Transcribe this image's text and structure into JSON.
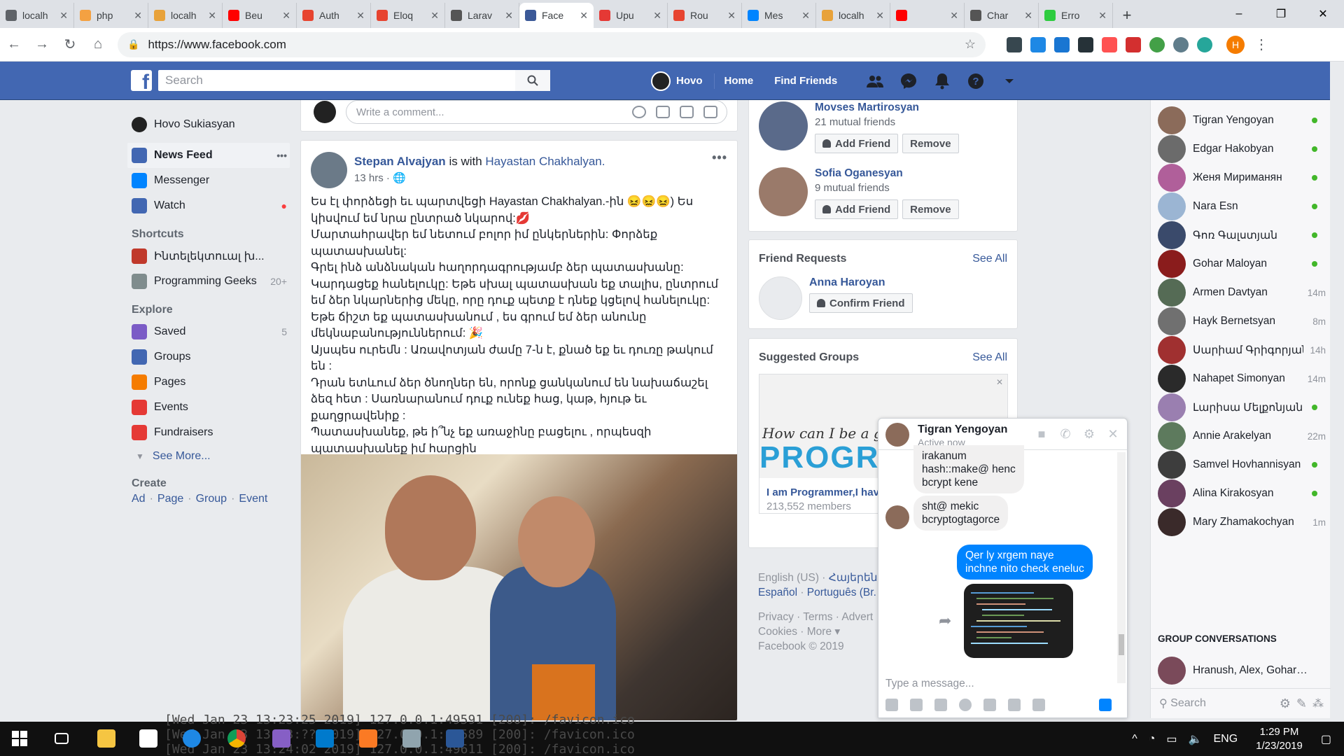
{
  "browser": {
    "tabs": [
      {
        "title": "localh",
        "color": "#5f6368"
      },
      {
        "title": "php",
        "color": "#f4a142"
      },
      {
        "title": "localh",
        "color": "#e8a23a"
      },
      {
        "title": "Bеu",
        "color": "#ff0000"
      },
      {
        "title": "Auth",
        "color": "#e74430"
      },
      {
        "title": "Eloq",
        "color": "#e74430"
      },
      {
        "title": "Larav",
        "color": "#555555"
      },
      {
        "title": "Face",
        "color": "#3b5998",
        "active": true
      },
      {
        "title": "Upu",
        "color": "#e53935"
      },
      {
        "title": "Rou",
        "color": "#e74430"
      },
      {
        "title": "Mes",
        "color": "#0084ff"
      },
      {
        "title": "localh",
        "color": "#e8a23a"
      },
      {
        "title": "",
        "color": "#ff0000"
      },
      {
        "title": "Char",
        "color": "#555555"
      },
      {
        "title": "Erro",
        "color": "#2ecc40"
      }
    ],
    "url": "https://www.facebook.com",
    "profile_initial": "H",
    "window_controls": [
      "–",
      "❐",
      "✕"
    ]
  },
  "fb": {
    "search_placeholder": "Search",
    "user_short": "Hovo",
    "nav_home": "Home",
    "nav_find_friends": "Find Friends"
  },
  "leftnav": {
    "profile_name": "Hovo Sukiasyan",
    "items": [
      {
        "label": "News Feed",
        "color": "#4267b2",
        "selected": true
      },
      {
        "label": "Messenger",
        "color": "#0084ff"
      },
      {
        "label": "Watch",
        "color": "#4267b2",
        "dot": true
      }
    ],
    "shortcuts_head": "Shortcuts",
    "shortcuts": [
      {
        "label": "Ինտելեկտուալ խ...",
        "color": "#c0392b",
        "count": ""
      },
      {
        "label": "Programming Geeks",
        "color": "#7f8c8d",
        "count": "20+"
      }
    ],
    "explore_head": "Explore",
    "explore": [
      {
        "label": "Saved",
        "color": "#7b5bc6",
        "count": "5"
      },
      {
        "label": "Groups",
        "color": "#4267b2",
        "count": ""
      },
      {
        "label": "Pages",
        "color": "#f57c00",
        "count": ""
      },
      {
        "label": "Events",
        "color": "#e53935",
        "count": ""
      },
      {
        "label": "Fundraisers",
        "color": "#e53935",
        "count": ""
      }
    ],
    "see_more": "See More...",
    "create_head": "Create",
    "create_links": [
      "Ad",
      "Page",
      "Group",
      "Event"
    ]
  },
  "comment_placeholder": "Write a comment...",
  "post": {
    "author": "Stepan Alvajyan",
    "with_text": "is with",
    "with_name": "Hayastan Chakhalyan.",
    "time": "13 hrs",
    "more": "•••",
    "text": "Ես էլ փորձեցի եւ պարտվեցի Hayastan Chakhalyan.-ին 😖😖😖) Ես կիսվում եմ նրա ընտրած նկարով:💋\nՄարտահրավեր եմ նետում բոլոր իմ ընկերներին: Փորձեք պատասխանել:\nԳրել ինձ անձնական հաղորդագրությամբ ձեր պատասխանը:\nԿարդացեք հանելուկը: Եթե սխալ պատասխան եք տալիս, ընտրում եմ ձեր նկարներից մեկը, որը դուք պետք է դնեք կցելով հանելուկը: Եթե ճիշտ եք պատասխանում , ես գրում եմ ձեր անունը մեկնաբանություններում: 🎉\nԱյսպես ուրեմն : Առավոտյան ժամը 7-ն է, քնած եք եւ դուռը թակում են :\nԴրան ետևում ձեր ծնողներ են, որոնք ցանկանում են նախաճաշել ձեզ հետ : Սառնարանում դուք ունեք հաց, կաթ, հյութ եւ քաղցրավենիք :\nՊատասխանեք, թե ի՞նչ եք առաջինը բացելու , որպեսզի պատասխանեք իմ հարցին\nՄիայն թե պատասխանը պետք է լինի անձնական նամակով :\nՄեկնաբանությունները կջնջվեն:"
  },
  "pymk": [
    {
      "name": "Movses Martirosyan",
      "mutual": "21 mutual friends",
      "add": "Add Friend",
      "remove": "Remove"
    },
    {
      "name": "Sofia Oganesyan",
      "mutual": "9 mutual friends",
      "add": "Add Friend",
      "remove": "Remove"
    }
  ],
  "friend_requests": {
    "title": "Friend Requests",
    "see_all": "See All",
    "name": "Anna Haroyan",
    "confirm": "Confirm Friend"
  },
  "suggested_groups": {
    "title": "Suggested Groups",
    "see_all": "See All",
    "img_line1": "How can I be a good",
    "img_line2": "PROGRA",
    "name": "I am Programmer,I have no life.",
    "members": "213,552 members",
    "close": "✕"
  },
  "footer": {
    "lang1": "English (US)",
    "lang1b": "Հայերեն",
    "lang2": "Español",
    "lang2b": "Português (Br...",
    "links1": "Privacy · Terms · Advert",
    "links2": "Cookies · More ▾",
    "copyright": "Facebook © 2019"
  },
  "contacts": [
    {
      "name": "Tigran Yengoyan",
      "status": "",
      "online": true,
      "color": "#8b6b5a"
    },
    {
      "name": "Edgar Hakobyan",
      "status": "",
      "online": true,
      "color": "#6b6b6b"
    },
    {
      "name": "Женя Мириманян",
      "status": "",
      "online": true,
      "color": "#b05f9a"
    },
    {
      "name": "Nara Esn",
      "status": "",
      "online": true,
      "color": "#9bb5d3"
    },
    {
      "name": "Գոռ Գալստյան",
      "status": "",
      "online": true,
      "color": "#3a4a6b"
    },
    {
      "name": "Gohar Maloyan",
      "status": "",
      "online": true,
      "color": "#8a1c1c"
    },
    {
      "name": "Armen Davtyan",
      "status": "14m",
      "online": false,
      "color": "#556b55"
    },
    {
      "name": "Hayk Bernetsyan",
      "status": "8m",
      "online": false,
      "color": "#707070"
    },
    {
      "name": "Սարիամ Գրիգորյան",
      "status": "14h",
      "online": false,
      "color": "#a03030"
    },
    {
      "name": "Nahapet Simonyan",
      "status": "14m",
      "online": false,
      "color": "#2a2a2a"
    },
    {
      "name": "Լարիսա Մելքոնյան",
      "status": "",
      "online": true,
      "color": "#9a7fb0"
    },
    {
      "name": "Annie Arakelyan",
      "status": "22m",
      "online": false,
      "color": "#5d7a5d"
    },
    {
      "name": "Samvel Hovhannisyan",
      "status": "",
      "online": true,
      "color": "#3d3d3d"
    },
    {
      "name": "Alina Kirakosyan",
      "status": "",
      "online": true,
      "color": "#6a4060"
    },
    {
      "name": "Mary Zhamakochyan",
      "status": "1m",
      "online": false,
      "color": "#3a2a2a"
    }
  ],
  "group_conversations_head": "GROUP CONVERSATIONS",
  "group_conv": {
    "name": "Hranush, Alex, Gohar…",
    "color": "#7a4a5a"
  },
  "chat_search": "Search",
  "chat": {
    "name": "Tigran Yengoyan",
    "status": "Active now",
    "msg1": "irakanum\nhash::make@ henc\nbcrypt kene",
    "msg2": "sht@ mekic\nbcryptogtagorce",
    "msg3": "Qer ly xrgem naye\ninchne nito check eneluc",
    "input_placeholder": "Type a message..."
  },
  "taskbar": {
    "terminal": "[Wed Jan 23 13:23:25 2019] 127.0.0.1:49591 [200]: /favicon.ico\n[Wed Jan 23 13:23:?? 2019] 127.0.0.1:49589 [200]: /favicon.ico\n[Wed Jan 23 13:24:02 2019] 127.0.0.1:49611 [200]: /favicon.ico",
    "lang": "ENG",
    "time": "1:29 PM",
    "date": "1/23/2019"
  }
}
